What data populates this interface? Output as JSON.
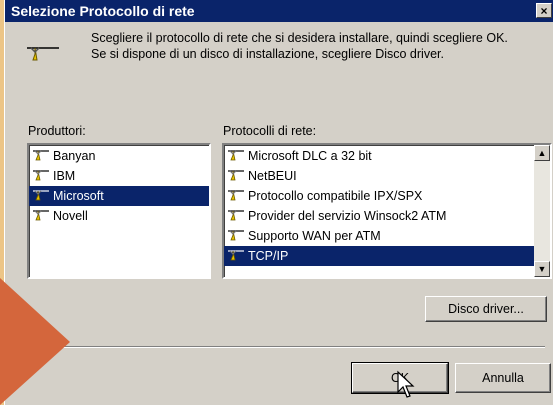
{
  "dialog": {
    "title": "Selezione Protocollo di rete",
    "close_glyph": "×",
    "intro_line1": "Scegliere il protocollo di rete che si desidera installare, quindi scegliere OK.",
    "intro_line2": "Se si dispone di un disco di installazione, scegliere Disco driver."
  },
  "manufacturers": {
    "label": "Produttori:",
    "items": [
      "Banyan",
      "IBM",
      "Microsoft",
      "Novell"
    ],
    "selected": "Microsoft"
  },
  "protocols": {
    "label": "Protocolli di rete:",
    "items": [
      "Microsoft DLC a 32 bit",
      "NetBEUI",
      "Protocollo compatibile IPX/SPX",
      "Provider del servizio Winsock2 ATM",
      "Supporto WAN per ATM",
      "TCP/IP"
    ],
    "selected": "TCP/IP"
  },
  "buttons": {
    "disk": "Disco driver...",
    "ok": "OK",
    "cancel": "Annulla"
  },
  "scrollbar": {
    "up": "▲",
    "down": "▼"
  },
  "colors": {
    "background": "#ecc587",
    "title_bar": "#0a246a",
    "dialog_face": "#d4d0c8",
    "selection": "#0a246a",
    "arrow": "#d4663c"
  },
  "icons": [
    "network-protocol-icon",
    "close-icon",
    "scroll-up-icon",
    "scroll-down-icon",
    "mouse-pointer-icon"
  ]
}
